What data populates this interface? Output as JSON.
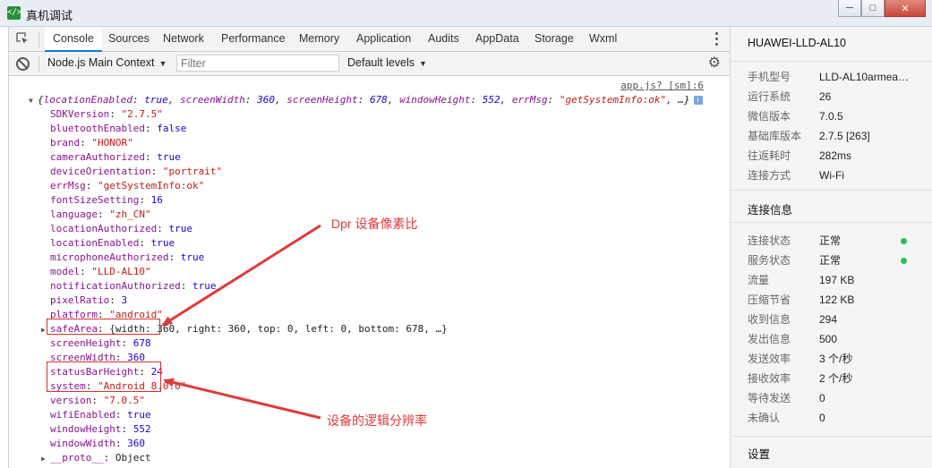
{
  "window": {
    "title": "真机调试",
    "icon_text": "</>",
    "buttons": {
      "minimize": "─",
      "maximize": "□",
      "close": "✕"
    }
  },
  "tabs": [
    {
      "label": "Console",
      "active": true
    },
    {
      "label": "Sources"
    },
    {
      "label": "Network"
    },
    {
      "label": "Performance"
    },
    {
      "label": "Memory"
    },
    {
      "label": "Application"
    },
    {
      "label": "Audits"
    },
    {
      "label": "AppData"
    },
    {
      "label": "Storage"
    },
    {
      "label": "Wxml"
    }
  ],
  "toolbar": {
    "context": "Node.js Main Context",
    "filter_placeholder": "Filter",
    "levels": "Default levels"
  },
  "console": {
    "source_link": "app.js? [sm]:6",
    "summary": {
      "open": "{",
      "k1": "locationEnabled",
      "v1": "true",
      "k2": "screenWidth",
      "v2": "360",
      "k3": "screenHeight",
      "v3": "678",
      "k4": "windowHeight",
      "v4": "552",
      "k5": "errMsg",
      "v5": "\"getSystemInfo:ok\"",
      "tail": ", …}",
      "badge": "i"
    },
    "props": [
      {
        "key": "SDKVersion",
        "value": "\"2.7.5\"",
        "type": "s"
      },
      {
        "key": "bluetoothEnabled",
        "value": "false",
        "type": "b"
      },
      {
        "key": "brand",
        "value": "\"HONOR\"",
        "type": "s"
      },
      {
        "key": "cameraAuthorized",
        "value": "true",
        "type": "b"
      },
      {
        "key": "deviceOrientation",
        "value": "\"portrait\"",
        "type": "s"
      },
      {
        "key": "errMsg",
        "value": "\"getSystemInfo:ok\"",
        "type": "s"
      },
      {
        "key": "fontSizeSetting",
        "value": "16",
        "type": "n"
      },
      {
        "key": "language",
        "value": "\"zh_CN\"",
        "type": "s"
      },
      {
        "key": "locationAuthorized",
        "value": "true",
        "type": "b"
      },
      {
        "key": "locationEnabled",
        "value": "true",
        "type": "b"
      },
      {
        "key": "microphoneAuthorized",
        "value": "true",
        "type": "b"
      },
      {
        "key": "model",
        "value": "\"LLD-AL10\"",
        "type": "s"
      },
      {
        "key": "notificationAuthorized",
        "value": "true",
        "type": "b"
      },
      {
        "key": "pixelRatio",
        "value": "3",
        "type": "n"
      },
      {
        "key": "platform",
        "value": "\"android\"",
        "type": "s"
      },
      {
        "key": "safeArea",
        "value": "{width: 360, right: 360, top: 0, left: 0, bottom: 678, …}",
        "type": "p"
      },
      {
        "key": "screenHeight",
        "value": "678",
        "type": "n"
      },
      {
        "key": "screenWidth",
        "value": "360",
        "type": "n"
      },
      {
        "key": "statusBarHeight",
        "value": "24",
        "type": "n"
      },
      {
        "key": "system",
        "value": "\"Android 8.0.0\"",
        "type": "s"
      },
      {
        "key": "version",
        "value": "\"7.0.5\"",
        "type": "s"
      },
      {
        "key": "wifiEnabled",
        "value": "true",
        "type": "b"
      },
      {
        "key": "windowHeight",
        "value": "552",
        "type": "n"
      },
      {
        "key": "windowWidth",
        "value": "360",
        "type": "n"
      },
      {
        "key": "__proto__",
        "value": "Object",
        "type": "p"
      }
    ]
  },
  "annotations": {
    "dpr_mono": "Dpr",
    "dpr_text": " 设备像素比",
    "resolution": "设备的逻辑分辨率"
  },
  "panel": {
    "device": "HUAWEI-LLD-AL10",
    "info": [
      {
        "label": "手机型号",
        "value": "LLD-AL10armea…"
      },
      {
        "label": "运行系统",
        "value": "26"
      },
      {
        "label": "微信版本",
        "value": "7.0.5"
      },
      {
        "label": "基础库版本",
        "value": "2.7.5 [263]"
      },
      {
        "label": "往返耗时",
        "value": "282ms"
      },
      {
        "label": "连接方式",
        "value": "Wi-Fi"
      }
    ],
    "connection_title": "连接信息",
    "connection": [
      {
        "label": "连接状态",
        "value": "正常",
        "status": "green"
      },
      {
        "label": "服务状态",
        "value": "正常",
        "status": "green"
      },
      {
        "label": "流量",
        "value": "197 KB"
      },
      {
        "label": "压缩节省",
        "value": "122 KB"
      },
      {
        "label": "收到信息",
        "value": "294"
      },
      {
        "label": "发出信息",
        "value": "500"
      },
      {
        "label": "发送效率",
        "value": "3 个/秒"
      },
      {
        "label": "接收效率",
        "value": "2 个/秒"
      },
      {
        "label": "等待发送",
        "value": "0"
      },
      {
        "label": "未确认",
        "value": "0"
      }
    ],
    "settings_title": "设置"
  },
  "colors": {
    "annotation_red": "#e03a3a",
    "status_green": "#2dbd5b",
    "active_tab_underline": "#1a73e8"
  }
}
